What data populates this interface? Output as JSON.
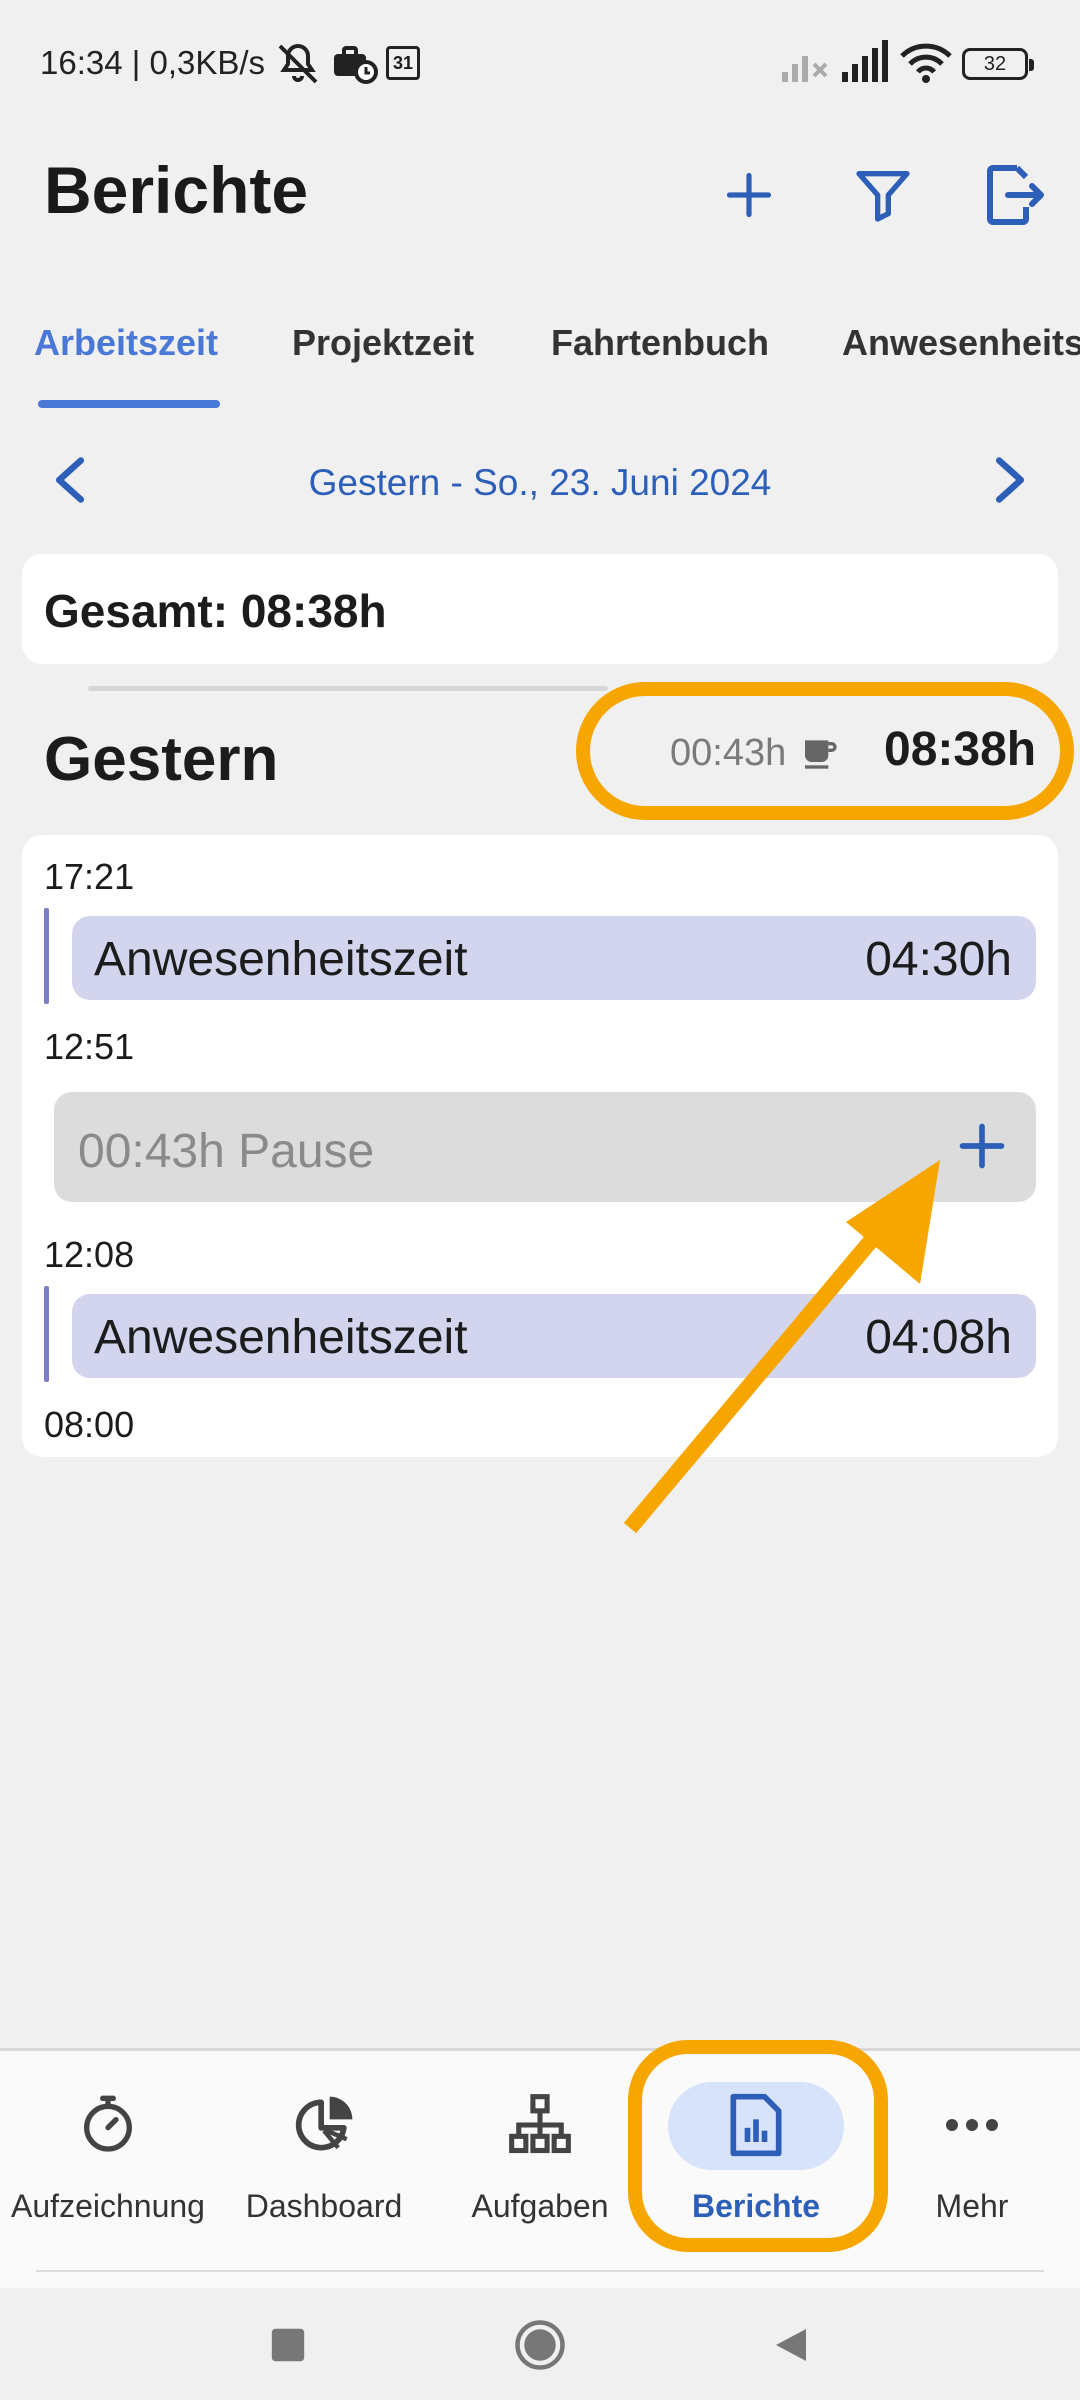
{
  "status_bar": {
    "time_speed": "16:34 | 0,3KB/s",
    "battery": "32",
    "icons": [
      "mute-icon",
      "briefcase-clock-icon",
      "calendar-31-icon",
      "signal-off-icon",
      "signal-icon",
      "wifi-icon",
      "battery-icon"
    ],
    "calendar_day": "31"
  },
  "header": {
    "title": "Berichte",
    "actions": [
      "add-icon",
      "filter-icon",
      "export-icon"
    ]
  },
  "tabs": [
    {
      "label": "Arbeitszeit",
      "active": true
    },
    {
      "label": "Projektzeit",
      "active": false
    },
    {
      "label": "Fahrtenbuch",
      "active": false
    },
    {
      "label": "Anwesenheits",
      "active": false
    }
  ],
  "date_nav": {
    "label": "Gestern - So., 23. Juni 2024"
  },
  "total": {
    "text": "Gesamt: 08:38h"
  },
  "day": {
    "title": "Gestern",
    "pause": "00:43h",
    "total": "08:38h"
  },
  "timeline": {
    "t1": "17:21",
    "entry1": {
      "label": "Anwesenheitszeit",
      "duration": "04:30h"
    },
    "t2": "12:51",
    "pause": {
      "label": "00:43h Pause"
    },
    "t3": "12:08",
    "entry2": {
      "label": "Anwesenheitszeit",
      "duration": "04:08h"
    },
    "t4": "08:00"
  },
  "bottom_nav": [
    {
      "label": "Aufzeichnung",
      "icon": "stopwatch-icon",
      "active": false
    },
    {
      "label": "Dashboard",
      "icon": "pie-chart-icon",
      "active": false
    },
    {
      "label": "Aufgaben",
      "icon": "hierarchy-icon",
      "active": false
    },
    {
      "label": "Berichte",
      "icon": "report-icon",
      "active": true
    },
    {
      "label": "Mehr",
      "icon": "more-icon",
      "active": false
    }
  ],
  "colors": {
    "accent": "#2d5fb8",
    "tab_active": "#4a78d6",
    "highlight": "#f7a600",
    "entry_bg": "#d3d4ee",
    "pill_bg": "#d7e2fb"
  }
}
